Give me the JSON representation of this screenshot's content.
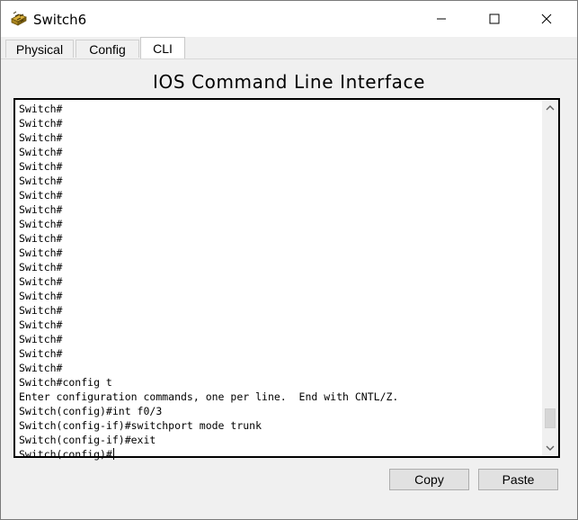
{
  "window": {
    "title": "Switch6",
    "icon": "switch-device-icon"
  },
  "controls": {
    "minimize_icon": "minimize-icon",
    "maximize_icon": "maximize-icon",
    "close_icon": "close-icon"
  },
  "tabs": [
    {
      "label": "Physical",
      "active": false
    },
    {
      "label": "Config",
      "active": false
    },
    {
      "label": "CLI",
      "active": true
    }
  ],
  "main": {
    "heading": "IOS Command Line Interface"
  },
  "terminal": {
    "lines": [
      "Switch#",
      "Switch#",
      "Switch#",
      "Switch#",
      "Switch#",
      "Switch#",
      "Switch#",
      "Switch#",
      "Switch#",
      "Switch#",
      "Switch#",
      "Switch#",
      "Switch#",
      "Switch#",
      "Switch#",
      "Switch#",
      "Switch#",
      "Switch#",
      "Switch#",
      "Switch#config t",
      "Enter configuration commands, one per line.  End with CNTL/Z.",
      "Switch(config)#int f0/3",
      "Switch(config-if)#switchport mode trunk",
      "Switch(config-if)#exit",
      "Switch(config)#"
    ],
    "scroll_position": 0.96
  },
  "buttons": {
    "copy": "Copy",
    "paste": "Paste"
  },
  "colors": {
    "window_bg": "#f0f0f0",
    "terminal_bg": "#ffffff",
    "terminal_border": "#000000",
    "button_bg": "#e1e1e1"
  }
}
